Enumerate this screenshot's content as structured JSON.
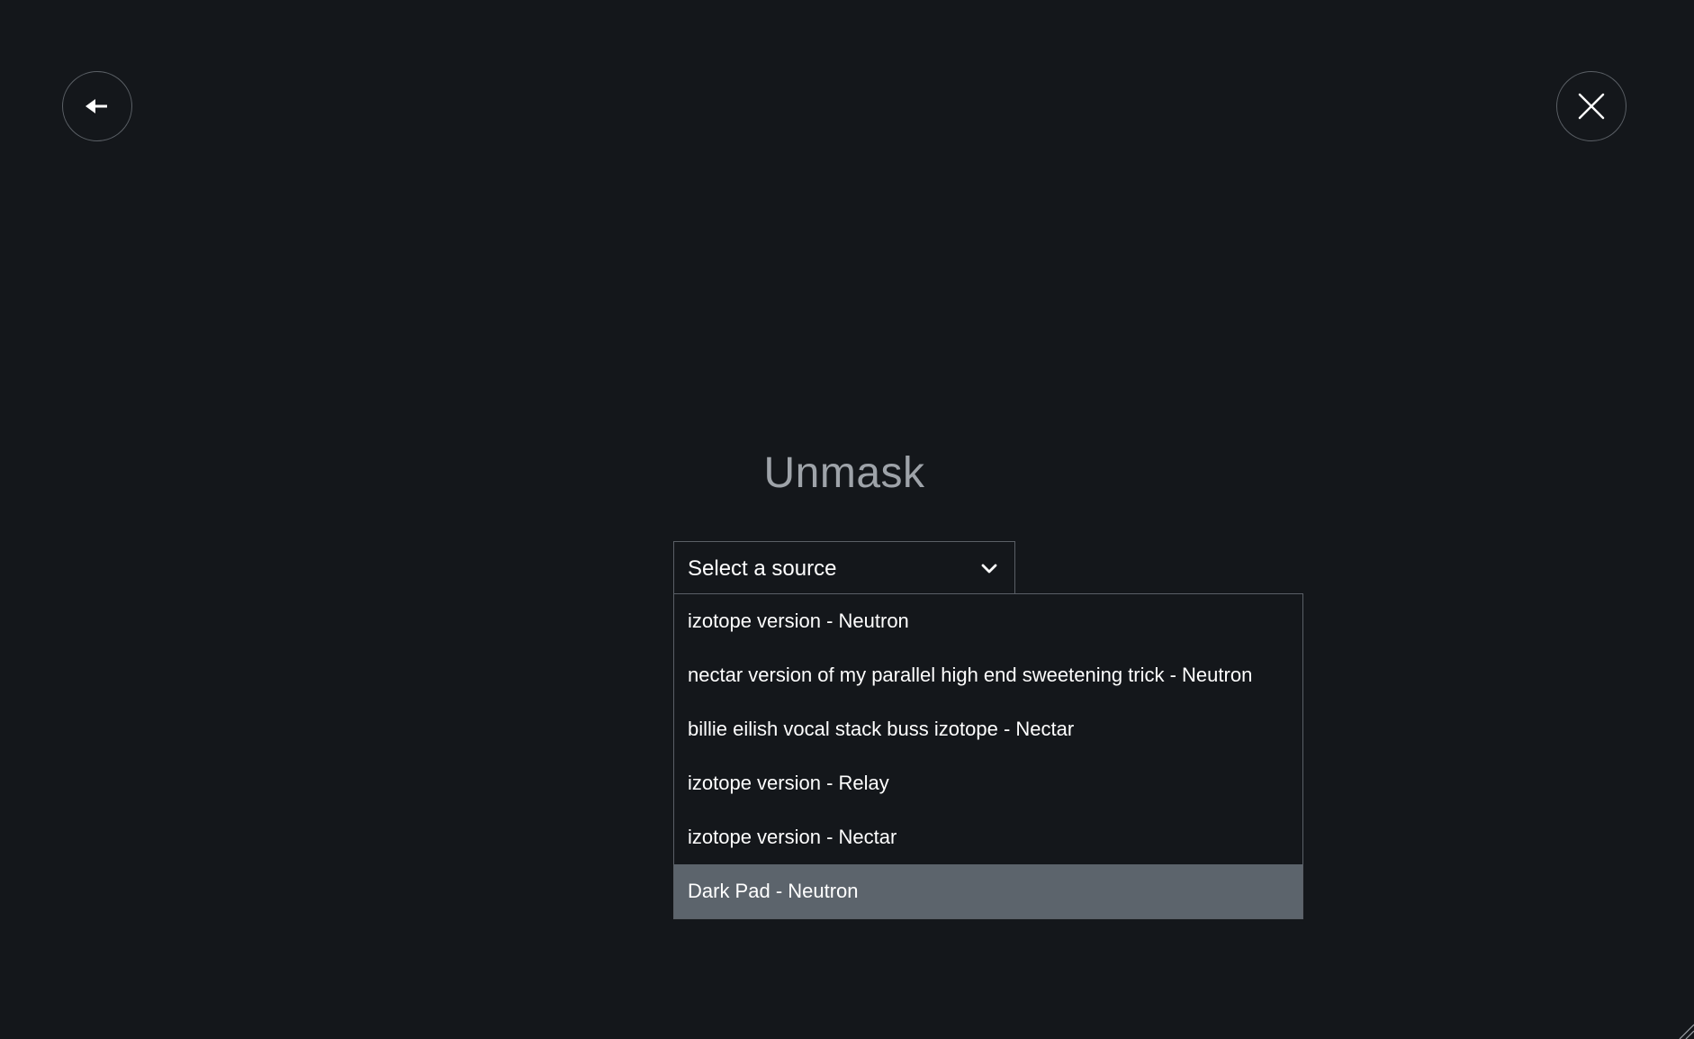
{
  "header": {
    "back_icon": "arrow-left-icon",
    "close_icon": "close-icon"
  },
  "main": {
    "title": "Unmask"
  },
  "source_select": {
    "placeholder": "Select a source",
    "icon": "chevron-down-icon",
    "options": [
      {
        "label": "izotope version - Neutron",
        "highlighted": false
      },
      {
        "label": "nectar version of my parallel high end sweetening trick - Neutron",
        "highlighted": false
      },
      {
        "label": "billie eilish vocal stack buss izotope - Nectar",
        "highlighted": false
      },
      {
        "label": "izotope version - Relay",
        "highlighted": false
      },
      {
        "label": "izotope version - Nectar",
        "highlighted": false
      },
      {
        "label": "Dark Pad - Neutron",
        "highlighted": true
      }
    ]
  },
  "colors": {
    "background": "#14171b",
    "border": "#5a5f66",
    "highlight": "#5c646c",
    "title": "#9ea3a9",
    "text": "#ffffff"
  }
}
